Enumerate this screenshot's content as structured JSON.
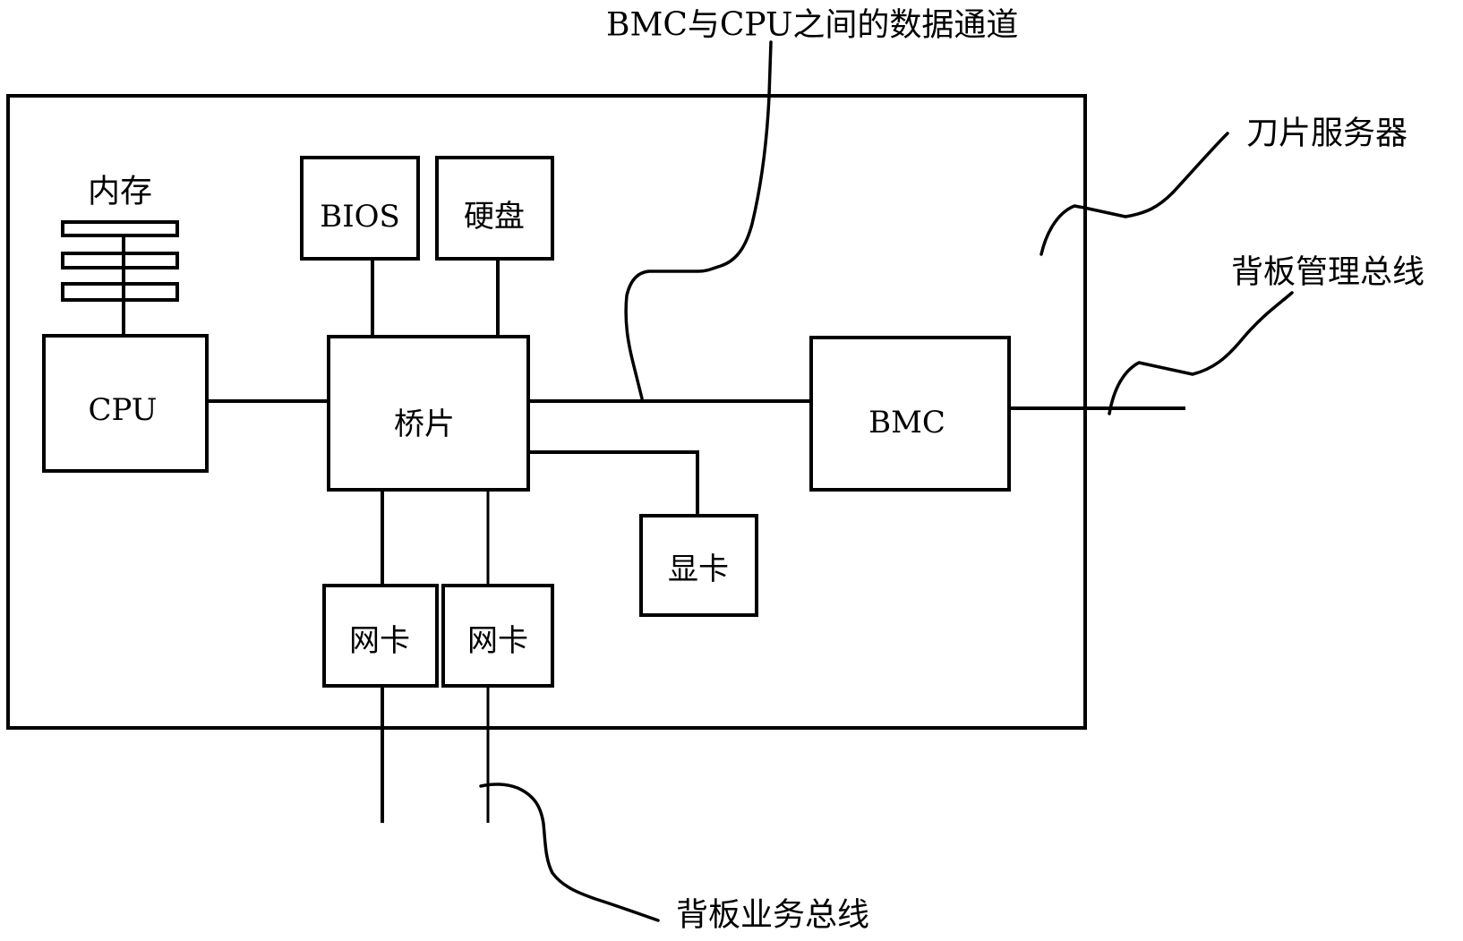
{
  "diagram": {
    "type": "block-diagram",
    "container": {
      "id": "blade_server",
      "label": "刀片服务器"
    },
    "components": {
      "memory": {
        "label": "内存",
        "stick_count": 3
      },
      "cpu": {
        "label": "CPU"
      },
      "bios": {
        "label": "BIOS"
      },
      "hdd": {
        "label": "硬盘"
      },
      "bridge": {
        "label": "桥片"
      },
      "gpu": {
        "label": "显卡"
      },
      "nic1": {
        "label": "网卡"
      },
      "nic2": {
        "label": "网卡"
      },
      "bmc": {
        "label": "BMC"
      }
    },
    "connections": [
      {
        "from": "memory",
        "to": "cpu"
      },
      {
        "from": "cpu",
        "to": "bridge"
      },
      {
        "from": "bios",
        "to": "bridge"
      },
      {
        "from": "hdd",
        "to": "bridge"
      },
      {
        "from": "bridge",
        "to": "bmc",
        "label": "BMC与CPU之间的数据通道"
      },
      {
        "from": "bridge",
        "to": "gpu"
      },
      {
        "from": "bridge",
        "to": "nic1"
      },
      {
        "from": "bridge",
        "to": "nic2"
      },
      {
        "from": "nic1",
        "to": "backplane_service_bus"
      },
      {
        "from": "nic2",
        "to": "backplane_service_bus"
      },
      {
        "from": "bmc",
        "to": "backplane_mgmt_bus"
      }
    ],
    "callouts": {
      "data_channel": "BMC与CPU之间的数据通道",
      "blade_server": "刀片服务器",
      "mgmt_bus": "背板管理总线",
      "service_bus": "背板业务总线"
    }
  }
}
